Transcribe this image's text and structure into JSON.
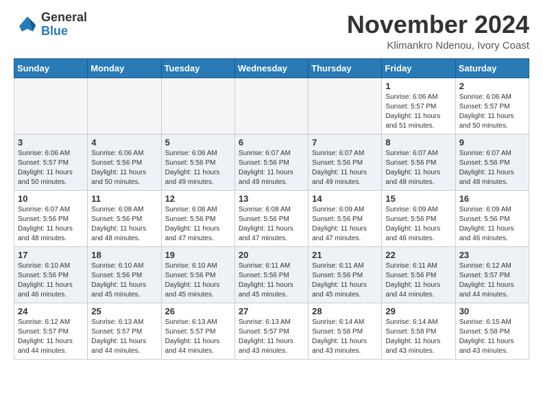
{
  "header": {
    "logo_general": "General",
    "logo_blue": "Blue",
    "month_title": "November 2024",
    "location": "Klimankro Ndenou, Ivory Coast"
  },
  "days_of_week": [
    "Sunday",
    "Monday",
    "Tuesday",
    "Wednesday",
    "Thursday",
    "Friday",
    "Saturday"
  ],
  "weeks": [
    [
      {
        "day": "",
        "info": ""
      },
      {
        "day": "",
        "info": ""
      },
      {
        "day": "",
        "info": ""
      },
      {
        "day": "",
        "info": ""
      },
      {
        "day": "",
        "info": ""
      },
      {
        "day": "1",
        "info": "Sunrise: 6:06 AM\nSunset: 5:57 PM\nDaylight: 11 hours and 51 minutes."
      },
      {
        "day": "2",
        "info": "Sunrise: 6:06 AM\nSunset: 5:57 PM\nDaylight: 11 hours and 50 minutes."
      }
    ],
    [
      {
        "day": "3",
        "info": "Sunrise: 6:06 AM\nSunset: 5:57 PM\nDaylight: 11 hours and 50 minutes."
      },
      {
        "day": "4",
        "info": "Sunrise: 6:06 AM\nSunset: 5:56 PM\nDaylight: 11 hours and 50 minutes."
      },
      {
        "day": "5",
        "info": "Sunrise: 6:06 AM\nSunset: 5:56 PM\nDaylight: 11 hours and 49 minutes."
      },
      {
        "day": "6",
        "info": "Sunrise: 6:07 AM\nSunset: 5:56 PM\nDaylight: 11 hours and 49 minutes."
      },
      {
        "day": "7",
        "info": "Sunrise: 6:07 AM\nSunset: 5:56 PM\nDaylight: 11 hours and 49 minutes."
      },
      {
        "day": "8",
        "info": "Sunrise: 6:07 AM\nSunset: 5:56 PM\nDaylight: 11 hours and 48 minutes."
      },
      {
        "day": "9",
        "info": "Sunrise: 6:07 AM\nSunset: 5:56 PM\nDaylight: 11 hours and 48 minutes."
      }
    ],
    [
      {
        "day": "10",
        "info": "Sunrise: 6:07 AM\nSunset: 5:56 PM\nDaylight: 11 hours and 48 minutes."
      },
      {
        "day": "11",
        "info": "Sunrise: 6:08 AM\nSunset: 5:56 PM\nDaylight: 11 hours and 48 minutes."
      },
      {
        "day": "12",
        "info": "Sunrise: 6:08 AM\nSunset: 5:56 PM\nDaylight: 11 hours and 47 minutes."
      },
      {
        "day": "13",
        "info": "Sunrise: 6:08 AM\nSunset: 5:56 PM\nDaylight: 11 hours and 47 minutes."
      },
      {
        "day": "14",
        "info": "Sunrise: 6:09 AM\nSunset: 5:56 PM\nDaylight: 11 hours and 47 minutes."
      },
      {
        "day": "15",
        "info": "Sunrise: 6:09 AM\nSunset: 5:56 PM\nDaylight: 11 hours and 46 minutes."
      },
      {
        "day": "16",
        "info": "Sunrise: 6:09 AM\nSunset: 5:56 PM\nDaylight: 11 hours and 46 minutes."
      }
    ],
    [
      {
        "day": "17",
        "info": "Sunrise: 6:10 AM\nSunset: 5:56 PM\nDaylight: 11 hours and 46 minutes."
      },
      {
        "day": "18",
        "info": "Sunrise: 6:10 AM\nSunset: 5:56 PM\nDaylight: 11 hours and 45 minutes."
      },
      {
        "day": "19",
        "info": "Sunrise: 6:10 AM\nSunset: 5:56 PM\nDaylight: 11 hours and 45 minutes."
      },
      {
        "day": "20",
        "info": "Sunrise: 6:11 AM\nSunset: 5:56 PM\nDaylight: 11 hours and 45 minutes."
      },
      {
        "day": "21",
        "info": "Sunrise: 6:11 AM\nSunset: 5:56 PM\nDaylight: 11 hours and 45 minutes."
      },
      {
        "day": "22",
        "info": "Sunrise: 6:11 AM\nSunset: 5:56 PM\nDaylight: 11 hours and 44 minutes."
      },
      {
        "day": "23",
        "info": "Sunrise: 6:12 AM\nSunset: 5:57 PM\nDaylight: 11 hours and 44 minutes."
      }
    ],
    [
      {
        "day": "24",
        "info": "Sunrise: 6:12 AM\nSunset: 5:57 PM\nDaylight: 11 hours and 44 minutes."
      },
      {
        "day": "25",
        "info": "Sunrise: 6:13 AM\nSunset: 5:57 PM\nDaylight: 11 hours and 44 minutes."
      },
      {
        "day": "26",
        "info": "Sunrise: 6:13 AM\nSunset: 5:57 PM\nDaylight: 11 hours and 44 minutes."
      },
      {
        "day": "27",
        "info": "Sunrise: 6:13 AM\nSunset: 5:57 PM\nDaylight: 11 hours and 43 minutes."
      },
      {
        "day": "28",
        "info": "Sunrise: 6:14 AM\nSunset: 5:58 PM\nDaylight: 11 hours and 43 minutes."
      },
      {
        "day": "29",
        "info": "Sunrise: 6:14 AM\nSunset: 5:58 PM\nDaylight: 11 hours and 43 minutes."
      },
      {
        "day": "30",
        "info": "Sunrise: 6:15 AM\nSunset: 5:58 PM\nDaylight: 11 hours and 43 minutes."
      }
    ]
  ]
}
